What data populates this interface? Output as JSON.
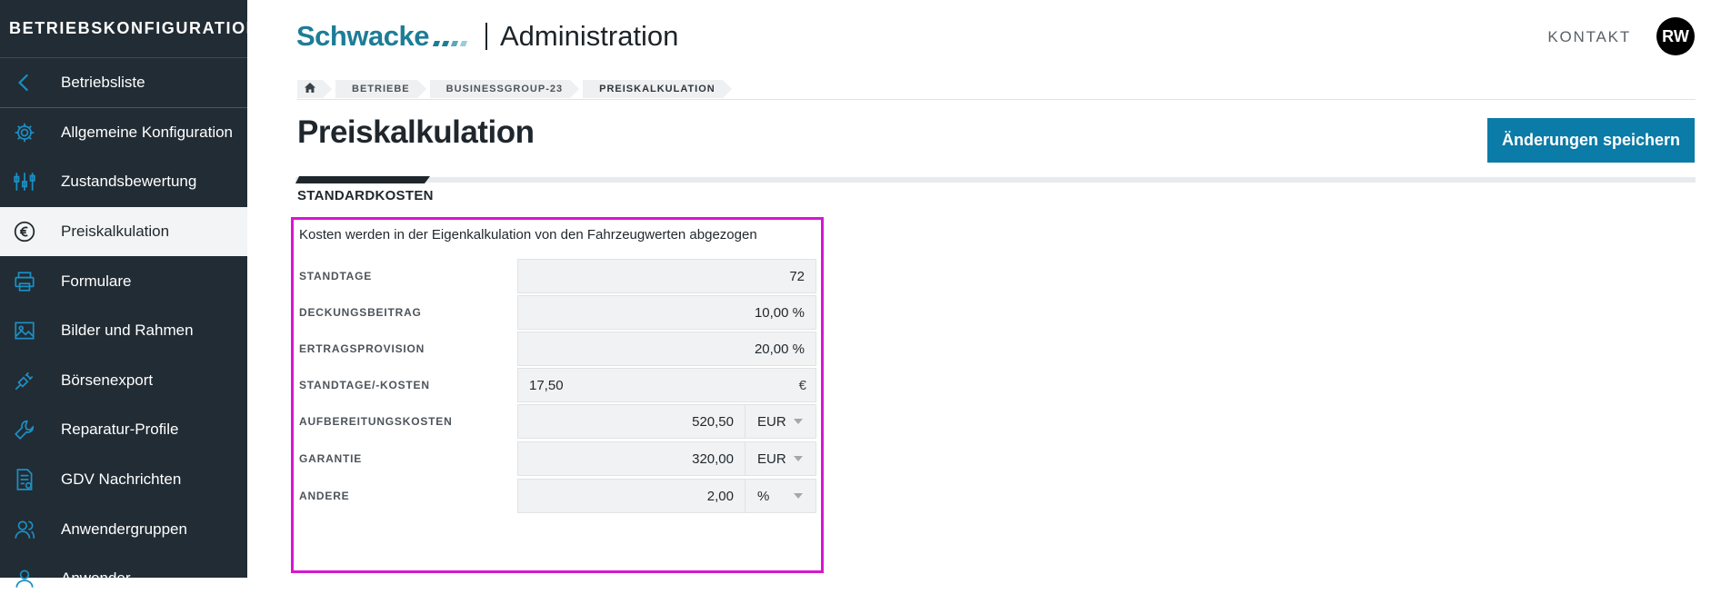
{
  "sidebar": {
    "title": "BETRIEBSKONFIGURATION",
    "items": [
      {
        "label": "Betriebsliste",
        "icon": "chevron-left-icon"
      },
      {
        "label": "Allgemeine Konfiguration",
        "icon": "gear-icon"
      },
      {
        "label": "Zustandsbewertung",
        "icon": "sliders-icon"
      },
      {
        "label": "Preiskalkulation",
        "icon": "euro-icon"
      },
      {
        "label": "Formulare",
        "icon": "printer-icon"
      },
      {
        "label": "Bilder und Rahmen",
        "icon": "image-icon"
      },
      {
        "label": "Börsenexport",
        "icon": "plug-icon"
      },
      {
        "label": "Reparatur-Profile",
        "icon": "wrench-icon"
      },
      {
        "label": "GDV Nachrichten",
        "icon": "document-icon"
      },
      {
        "label": "Anwendergruppen",
        "icon": "users-icon"
      },
      {
        "label": "Anwender",
        "icon": "user-icon"
      }
    ],
    "accent": "#1b8fc4"
  },
  "header": {
    "logo": "Schwacke",
    "app_title": "Administration",
    "contact": "KONTAKT",
    "avatar": "RW"
  },
  "breadcrumb": [
    "BETRIEBE",
    "BUSINESSGROUP-23",
    "PREISKALKULATION"
  ],
  "page": {
    "title": "Preiskalkulation",
    "save_button": "Änderungen speichern",
    "tab": "STANDARDKOSTEN"
  },
  "form": {
    "description": "Kosten werden in der Eigenkalkulation von den Fahrzeugwerten abgezogen",
    "rows": [
      {
        "label": "STANDTAGE",
        "value": "72"
      },
      {
        "label": "DECKUNGSBEITRAG",
        "value": "10,00 %"
      },
      {
        "label": "ERTRAGSPROVISION",
        "value": "20,00 %"
      },
      {
        "label": "STANDTAGE/-KOSTEN",
        "value": "17,50",
        "suffix": "€"
      },
      {
        "label": "AUFBEREITUNGSKOSTEN",
        "value": "520,50",
        "unit": "EUR"
      },
      {
        "label": "GARANTIE",
        "value": "320,00",
        "unit": "EUR"
      },
      {
        "label": "ANDERE",
        "value": "2,00",
        "unit": "%"
      }
    ]
  },
  "colors": {
    "primary": "#0b7ba7",
    "sidebar_bg": "#222c34",
    "highlight": "#d617d0"
  }
}
